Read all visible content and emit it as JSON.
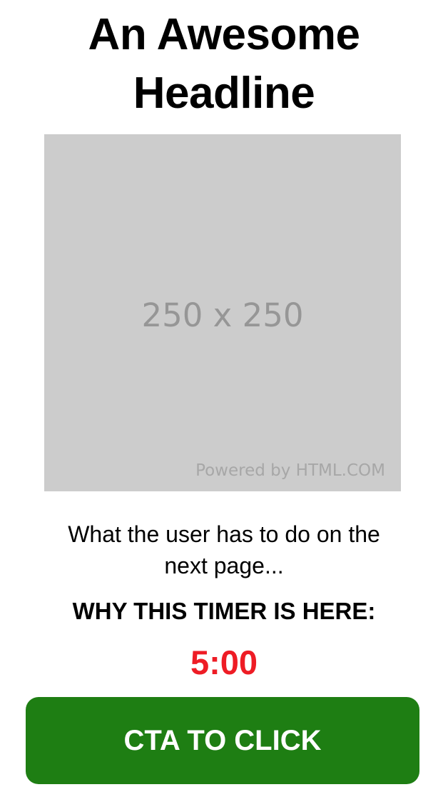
{
  "headline": {
    "line1": "An Awesome",
    "line2": "Headline"
  },
  "placeholder_image": {
    "size_text": "250 x 250",
    "credit_text": "Powered by HTML.COM",
    "background_color": "#cccccc"
  },
  "instruction": {
    "line1": "What the user has to do on the",
    "line2": "next page..."
  },
  "timer_reason": "WHY THIS TIMER IS HERE:",
  "timer": {
    "value": "5:00",
    "color": "#ee1c25"
  },
  "cta": {
    "label": "CTA TO CLICK",
    "color": "#1e7e13"
  }
}
